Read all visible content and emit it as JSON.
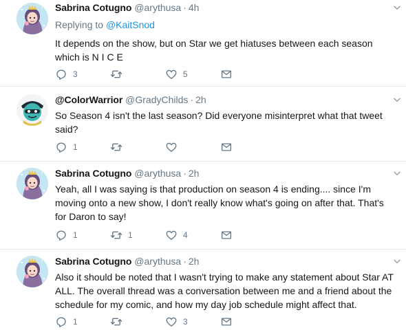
{
  "colors": {
    "name_text": "#14171a",
    "secondary_text": "#657786",
    "link": "#1b95e0",
    "divider": "#e1e8ed",
    "icon": "#657786"
  },
  "tweets": [
    {
      "name": "Sabrina Cotugno",
      "handle": "@arythusa",
      "separator": "·",
      "time": "4h",
      "reply_prefix": "Replying to",
      "reply_mention": "@KaitSnod",
      "text": "It depends on the show, but on Star we get hiatuses between each season which is N I C E",
      "reply_count": "3",
      "retweet_count": "",
      "like_count": "5",
      "avatar_icon": "sabrina-avatar-icon"
    },
    {
      "name": "@ColorWarrior",
      "handle": "@GradyChilds",
      "separator": "·",
      "time": "2h",
      "text": "So Season 4 isn't the last season? Did everyone misinterpret what that tweet said?",
      "reply_count": "1",
      "retweet_count": "",
      "like_count": "",
      "avatar_icon": "colorwarrior-avatar-icon"
    },
    {
      "name": "Sabrina Cotugno",
      "handle": "@arythusa",
      "separator": "·",
      "time": "2h",
      "text": "Yeah, all I was saying is that production on season 4 is ending.... since I'm moving onto a new show, I don't really know what's going on after that. That's for Daron to say!",
      "reply_count": "1",
      "retweet_count": "1",
      "like_count": "4",
      "avatar_icon": "sabrina-avatar-icon"
    },
    {
      "name": "Sabrina Cotugno",
      "handle": "@arythusa",
      "separator": "·",
      "time": "2h",
      "text": "Also it should be noted that I wasn't trying to make any statement about Star AT ALL. The overall thread was a conversation between me and a friend about the schedule for my comic, and how my day job schedule might affect that.",
      "reply_count": "1",
      "retweet_count": "",
      "like_count": "3",
      "avatar_icon": "sabrina-avatar-icon"
    }
  ]
}
